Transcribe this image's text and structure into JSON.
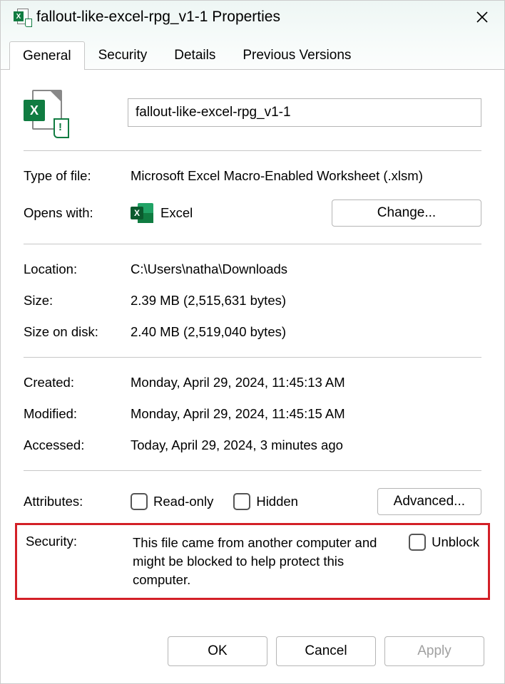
{
  "window": {
    "title": "fallout-like-excel-rpg_v1-1 Properties"
  },
  "tabs": {
    "general": "General",
    "security": "Security",
    "details": "Details",
    "previous": "Previous Versions"
  },
  "file": {
    "name_value": "fallout-like-excel-rpg_v1-1"
  },
  "labels": {
    "type": "Type of file:",
    "opens": "Opens with:",
    "location": "Location:",
    "size": "Size:",
    "sizeondisk": "Size on disk:",
    "created": "Created:",
    "modified": "Modified:",
    "accessed": "Accessed:",
    "attributes": "Attributes:",
    "security": "Security:"
  },
  "values": {
    "type": "Microsoft Excel Macro-Enabled Worksheet (.xlsm)",
    "opens_app": "Excel",
    "location": "C:\\Users\\natha\\Downloads",
    "size": "2.39 MB (2,515,631 bytes)",
    "sizeondisk": "2.40 MB (2,519,040 bytes)",
    "created": "Monday, April 29, 2024, 11:45:13 AM",
    "modified": "Monday, April 29, 2024, 11:45:15 AM",
    "accessed": "Today, April 29, 2024, 3 minutes ago"
  },
  "attributes": {
    "readonly": "Read-only",
    "hidden": "Hidden"
  },
  "security_section": {
    "text": "This file came from another computer and might be blocked to help protect this computer.",
    "unblock": "Unblock"
  },
  "buttons": {
    "change": "Change...",
    "advanced": "Advanced...",
    "ok": "OK",
    "cancel": "Cancel",
    "apply": "Apply"
  }
}
